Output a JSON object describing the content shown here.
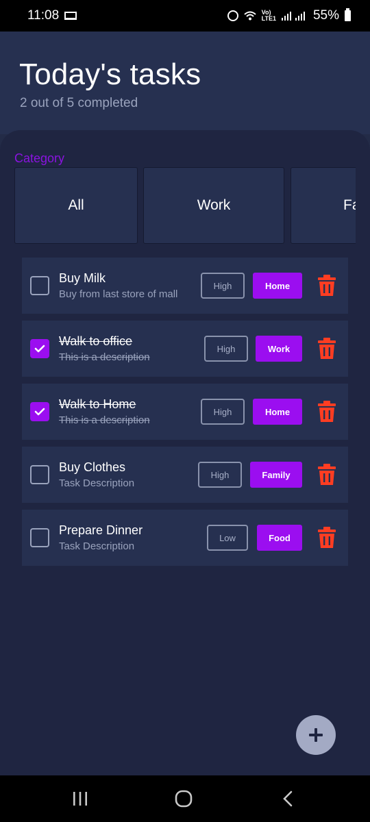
{
  "status_bar": {
    "time": "11:08",
    "battery_percent": "55%",
    "lte_label": "Vo)\nLTE1"
  },
  "header": {
    "title": "Today's tasks",
    "subtitle": "2 out of 5 completed"
  },
  "categories": {
    "label": "Category",
    "items": [
      "All",
      "Work",
      "Fa"
    ]
  },
  "tasks": [
    {
      "title": "Buy Milk",
      "description": "Buy from last store of mall",
      "priority": "High",
      "category": "Home",
      "completed": false
    },
    {
      "title": "Walk to office",
      "description": "This is a description",
      "priority": "High",
      "category": "Work",
      "completed": true
    },
    {
      "title": "Walk to Home",
      "description": "This is a description",
      "priority": "High",
      "category": "Home",
      "completed": true
    },
    {
      "title": "Buy Clothes",
      "description": "Task Description",
      "priority": "High",
      "category": "Family",
      "completed": false
    },
    {
      "title": "Prepare Dinner",
      "description": "Task Description",
      "priority": "Low",
      "category": "Food",
      "completed": false
    }
  ],
  "colors": {
    "accent": "#9b0ef0",
    "delete": "#ff3d22",
    "background": "#1f2541",
    "card": "#263050"
  },
  "icons": {
    "fab": "plus-icon",
    "delete": "trash-icon",
    "nav": [
      "recent-apps-icon",
      "home-icon",
      "back-icon"
    ]
  }
}
